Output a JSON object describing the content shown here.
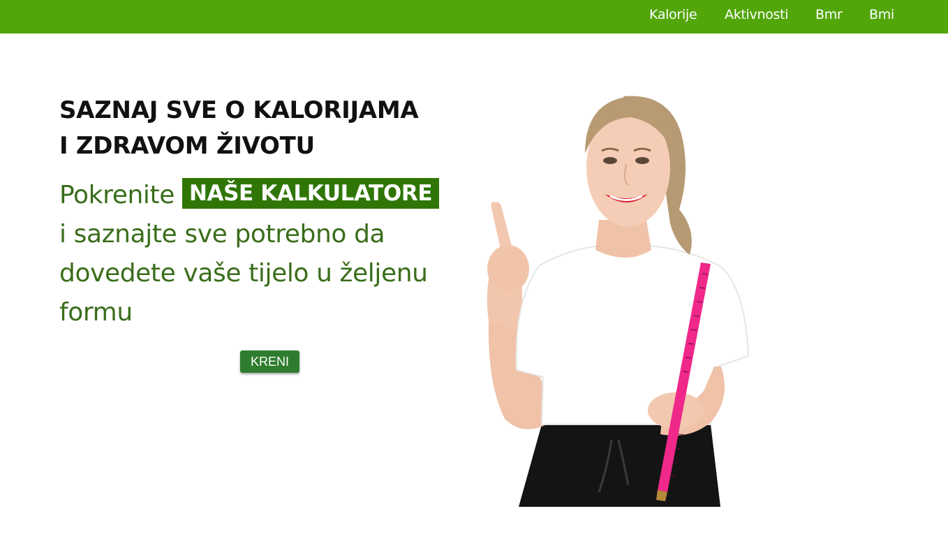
{
  "nav": {
    "items": [
      "Kalorije",
      "Aktivnosti",
      "Bmr",
      "Bmi"
    ],
    "background": "#52a60a"
  },
  "hero": {
    "headline_line1": "SAZNAJ SVE O KALORIJAMA",
    "headline_line2": "I ZDRAVOM ŽIVOTU",
    "tagline_before": "Pokrenite ",
    "tagline_highlight": "NAŠE KALKULATORE",
    "tagline_after": " i saznajte sve potrebno da dovedete vaše tijelo u željenu formu",
    "cta_label": "KRENI",
    "text_color": "#3a6d1a",
    "highlight_color": "#2f7606"
  },
  "image": {
    "subject": "woman-with-measuring-tape"
  }
}
